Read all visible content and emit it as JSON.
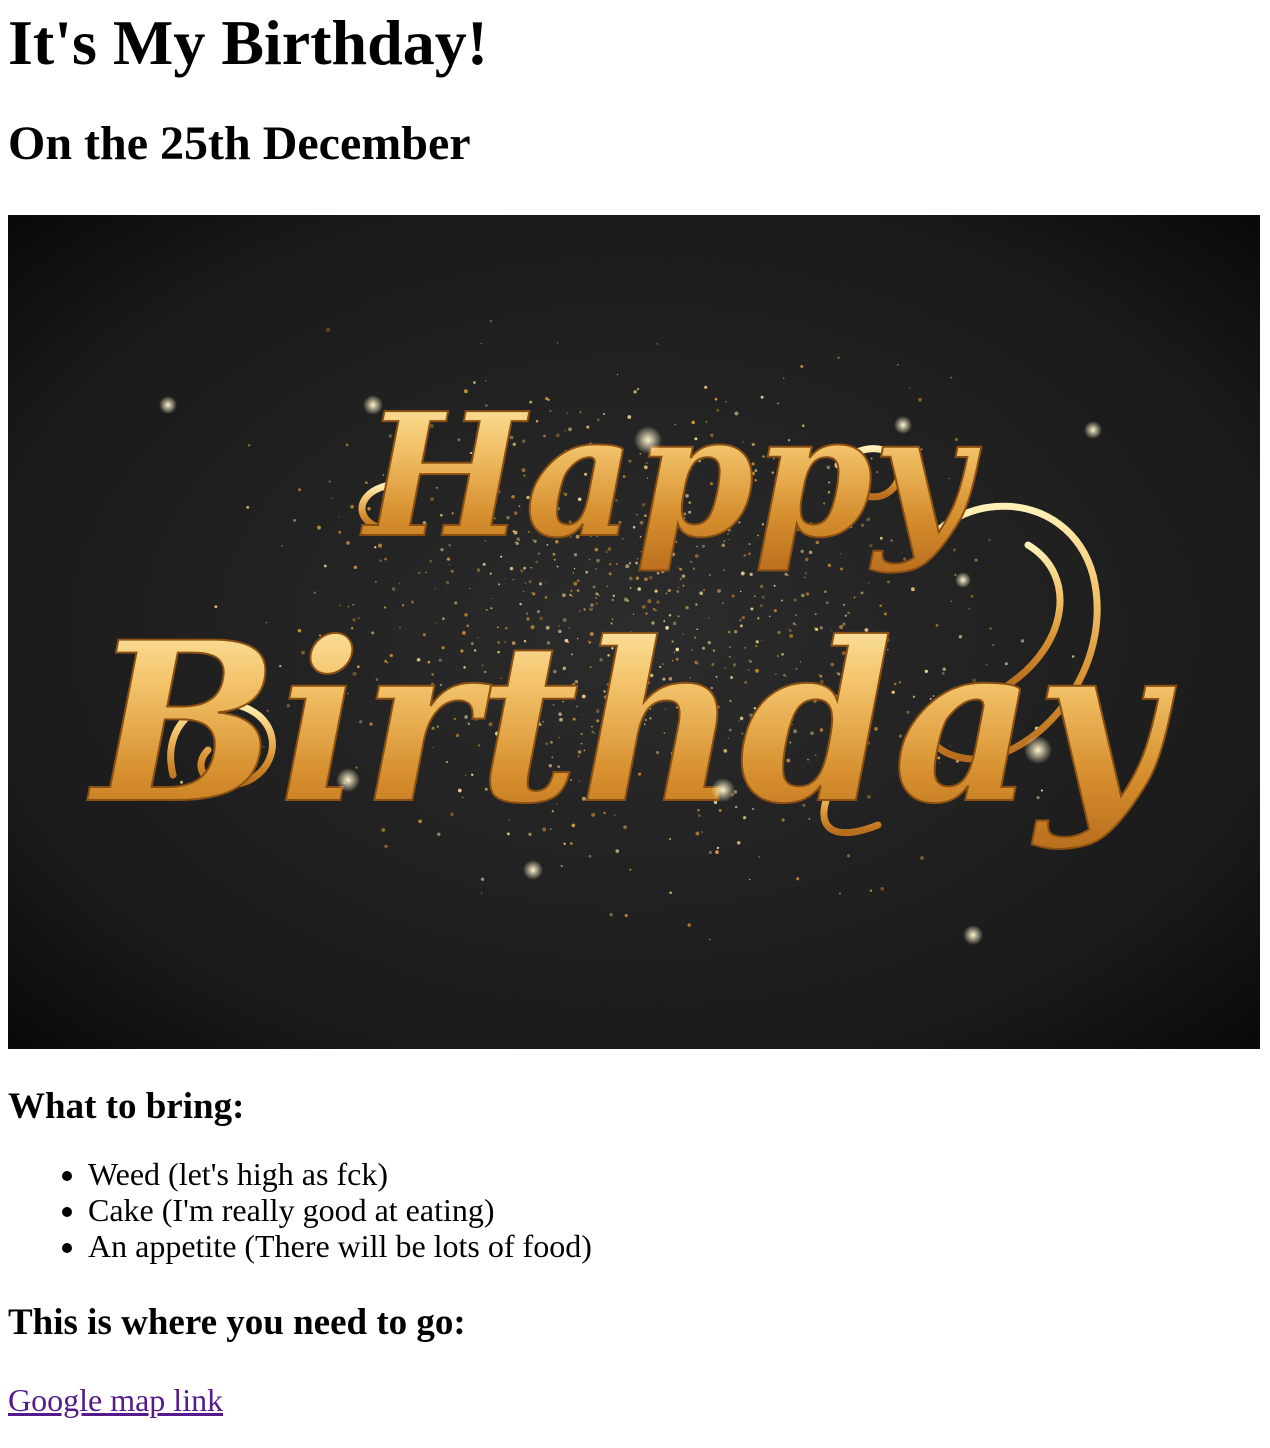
{
  "title": "It's My Birthday!",
  "subtitle": "On the 25th December",
  "banner": {
    "line1": "Happy",
    "line2": "Birthday",
    "bg_color": "#1c1c1c",
    "gold_color": "#e8a947"
  },
  "bring": {
    "heading": "What to bring:",
    "items": [
      "Weed (let's high as fck)",
      "Cake (I'm really good at eating)",
      "An appetite (There will be lots of food)"
    ]
  },
  "location": {
    "heading": "This is where you need to go:",
    "link_text": "Google map link",
    "link_color": "#551a8b"
  }
}
